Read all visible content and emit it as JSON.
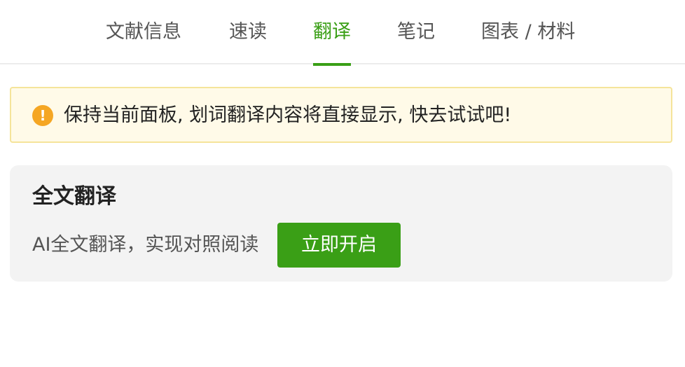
{
  "tabs": [
    {
      "label": "文献信息",
      "active": false
    },
    {
      "label": "速读",
      "active": false
    },
    {
      "label": "翻译",
      "active": true
    },
    {
      "label": "笔记",
      "active": false
    },
    {
      "label": "图表 / 材料",
      "active": false
    }
  ],
  "notice": {
    "icon": "warning-icon",
    "icon_glyph": "!",
    "text": "保持当前面板, 划词翻译内容将直接显示, 快去试试吧!"
  },
  "full_translation": {
    "title": "全文翻译",
    "description": "AI全文翻译，实现对照阅读",
    "button_label": "立即开启"
  },
  "colors": {
    "accent": "#3a9f16",
    "warning": "#f5a623",
    "notice_bg": "#fffae8",
    "card_bg": "#f3f3f3"
  }
}
